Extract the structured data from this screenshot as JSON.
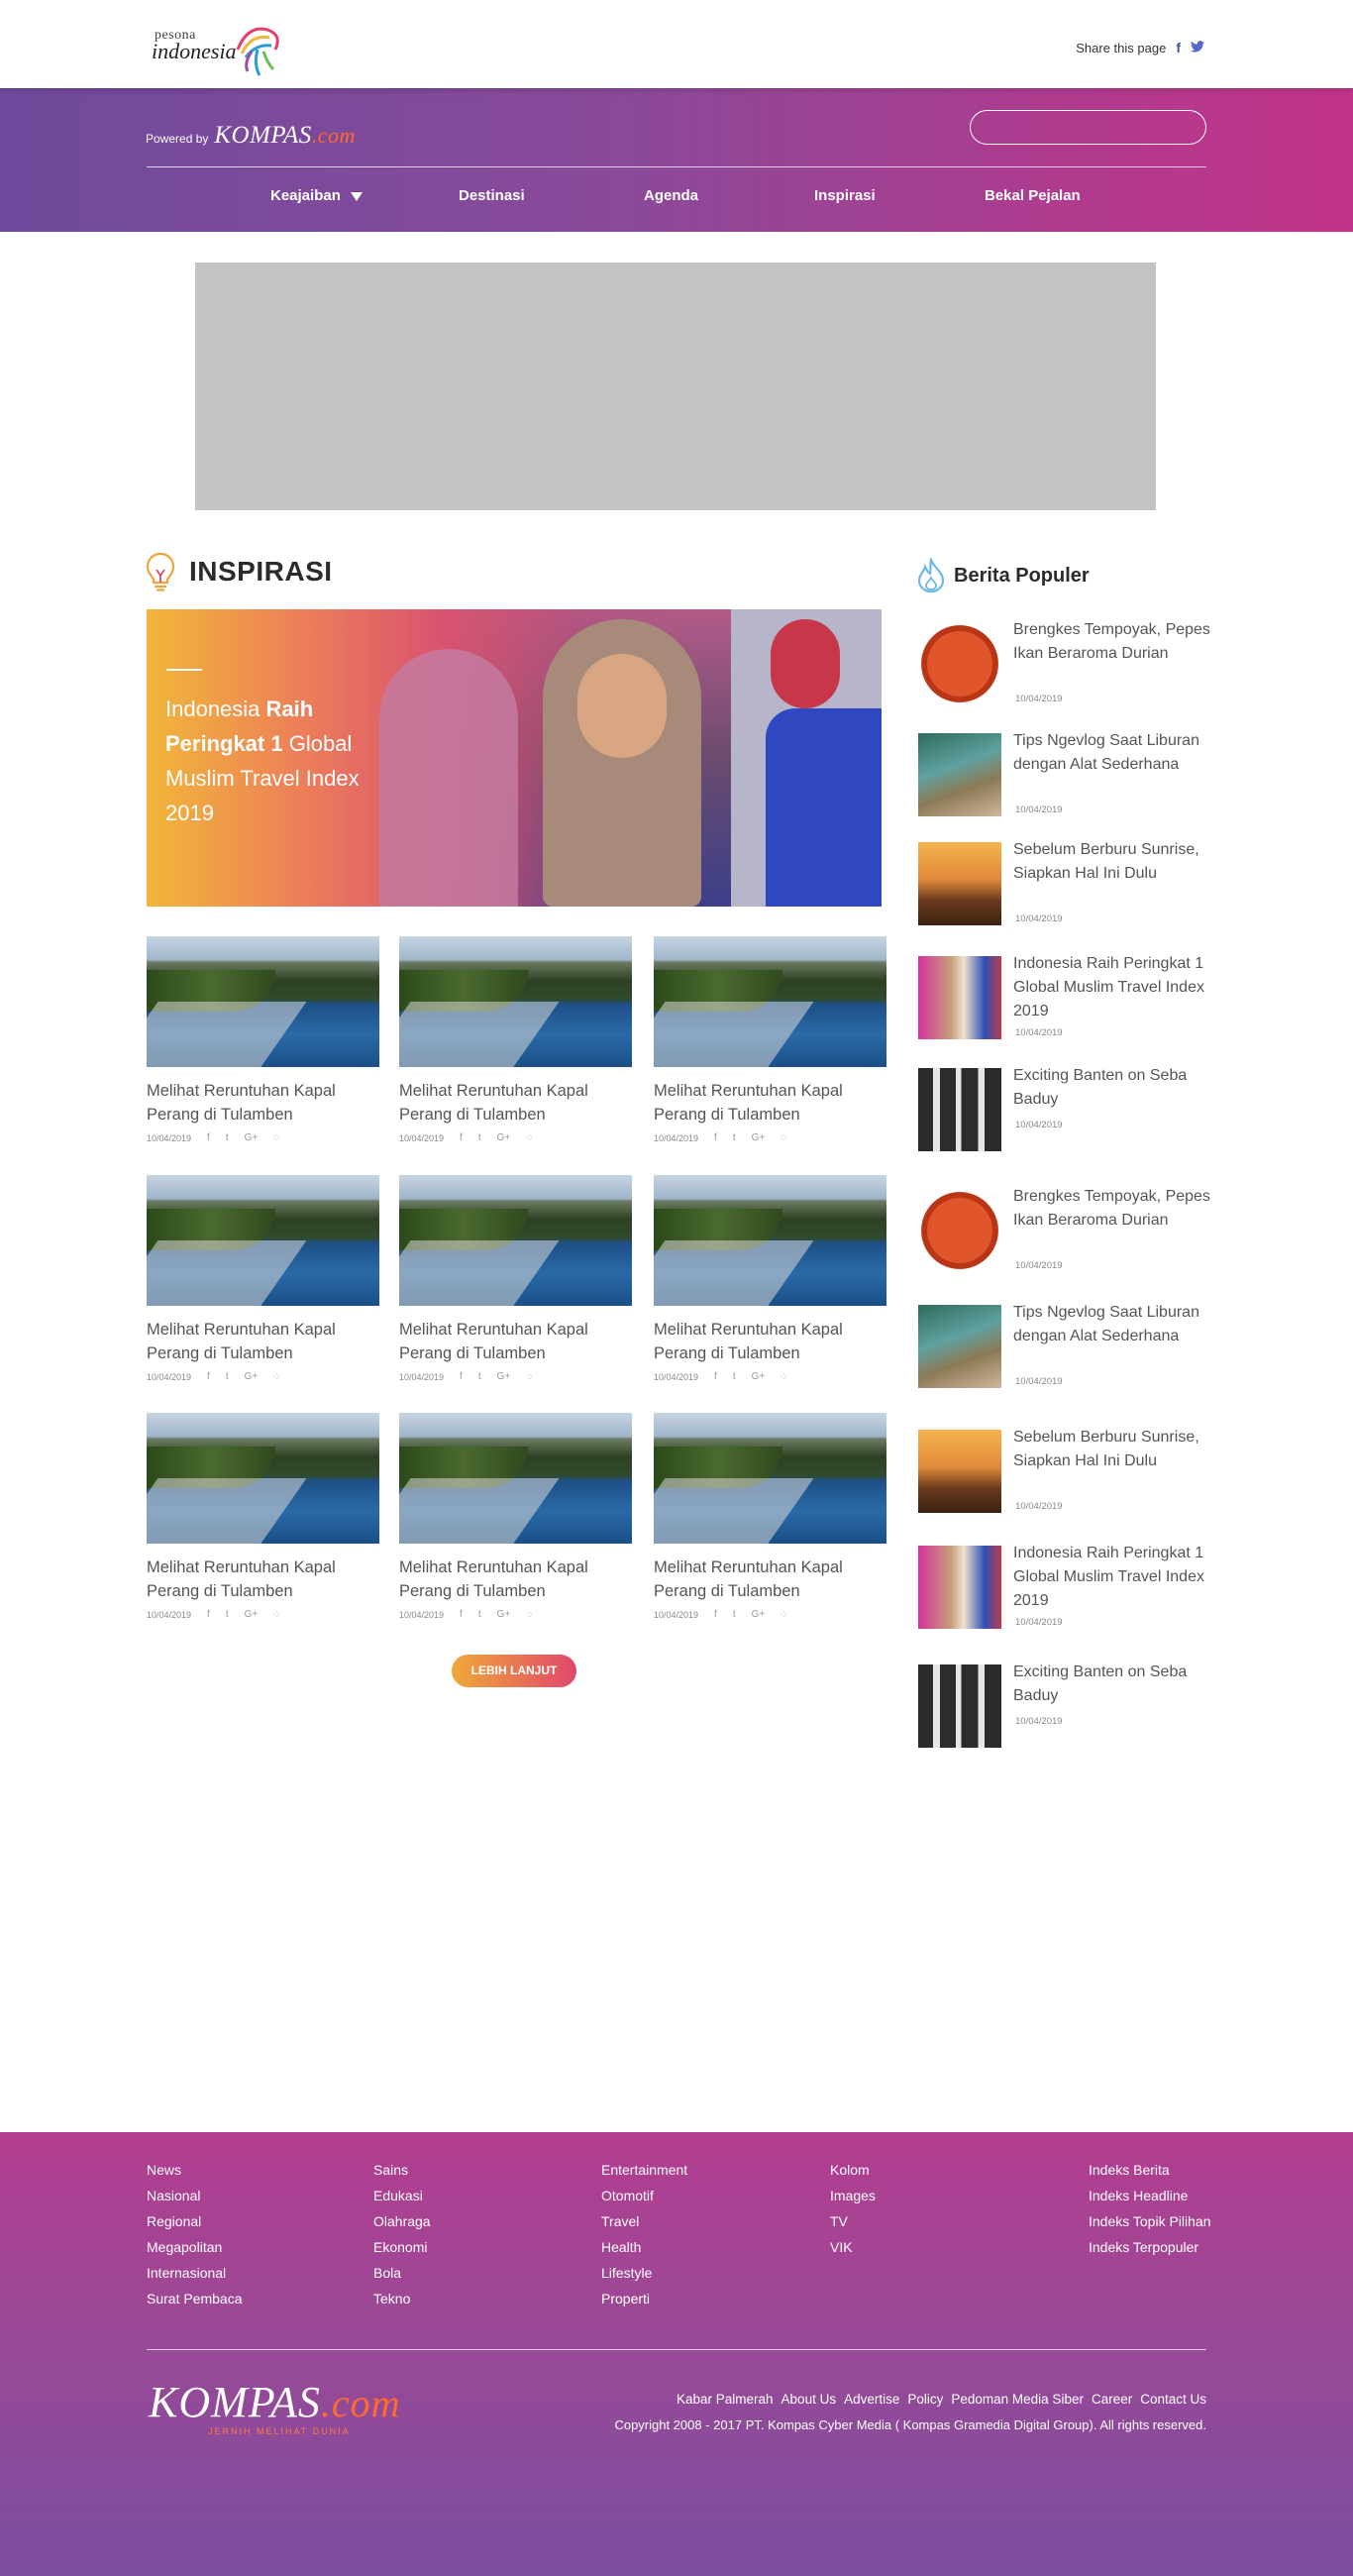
{
  "brand": {
    "pesona": "pesona",
    "indonesia": "indonesia"
  },
  "share": {
    "label": "Share this page",
    "fb": "f",
    "tw": "🐦"
  },
  "header": {
    "powered_by": "Powered by",
    "kompas": "KOMPAS",
    "kompas_dot": ".com",
    "search_placeholder": ""
  },
  "nav": [
    {
      "label": "Keajaiban",
      "caret": true
    },
    {
      "label": "Destinasi"
    },
    {
      "label": "Agenda"
    },
    {
      "label": "Inspirasi"
    },
    {
      "label": "Bekal Pejalan"
    }
  ],
  "section": {
    "title": "INSPIRASI"
  },
  "hero": {
    "pre": "Indonesia ",
    "bold": "Raih Peringkat 1",
    "post": " Global Muslim Travel Index 2019"
  },
  "cards": [
    {
      "title": "Melihat Reruntuhan Kapal Perang di Tulamben",
      "date": "10/04/2019"
    },
    {
      "title": "Melihat Reruntuhan Kapal Perang di Tulamben",
      "date": "10/04/2019"
    },
    {
      "title": "Melihat Reruntuhan Kapal Perang di Tulamben",
      "date": "10/04/2019"
    },
    {
      "title": "Melihat Reruntuhan Kapal Perang di Tulamben",
      "date": "10/04/2019"
    },
    {
      "title": "Melihat Reruntuhan Kapal Perang di Tulamben",
      "date": "10/04/2019"
    },
    {
      "title": "Melihat Reruntuhan Kapal Perang di Tulamben",
      "date": "10/04/2019"
    },
    {
      "title": "Melihat Reruntuhan Kapal Perang di Tulamben",
      "date": "10/04/2019"
    },
    {
      "title": "Melihat Reruntuhan Kapal Perang di Tulamben",
      "date": "10/04/2019"
    },
    {
      "title": "Melihat Reruntuhan Kapal Perang di Tulamben",
      "date": "10/04/2019"
    }
  ],
  "share_icons": {
    "fb": "f",
    "tw": "t",
    "gp": "G+",
    "wa": "◌"
  },
  "more_button": "LEBIH LANJUT",
  "sidebar": {
    "title": "Berita Populer",
    "items": [
      {
        "title": "Brengkes Tempoyak, Pepes Ikan Beraroma Durian",
        "date": "10/04/2019",
        "thumb": "food"
      },
      {
        "title": "Tips Ngevlog Saat Liburan dengan Alat Sederhana",
        "date": "10/04/2019",
        "thumb": "swim"
      },
      {
        "title": "Sebelum Berburu Sunrise, Siapkan Hal Ini Dulu",
        "date": "10/04/2019",
        "thumb": "sun"
      },
      {
        "title": "Indonesia Raih Peringkat 1 Global Muslim Travel Index 2019",
        "date": "10/04/2019",
        "thumb": "hijab"
      },
      {
        "title": "Exciting Banten on Seba Baduy",
        "date": "10/04/2019",
        "thumb": "band"
      },
      {
        "title": "Brengkes Tempoyak, Pepes Ikan Beraroma Durian",
        "date": "10/04/2019",
        "thumb": "food"
      },
      {
        "title": "Tips Ngevlog Saat Liburan dengan Alat Sederhana",
        "date": "10/04/2019",
        "thumb": "swim"
      },
      {
        "title": "Sebelum Berburu Sunrise, Siapkan Hal Ini Dulu",
        "date": "10/04/2019",
        "thumb": "sun"
      },
      {
        "title": "Indonesia Raih Peringkat 1 Global Muslim Travel Index 2019",
        "date": "10/04/2019",
        "thumb": "hijab"
      },
      {
        "title": "Exciting Banten on Seba Baduy",
        "date": "10/04/2019",
        "thumb": "band"
      }
    ]
  },
  "footer": {
    "columns": [
      [
        "News",
        "Nasional",
        "Regional",
        "Megapolitan",
        "Internasional",
        "Surat Pembaca"
      ],
      [
        "Sains",
        "Edukasi",
        "Olahraga",
        "Ekonomi",
        "Bola",
        "Tekno"
      ],
      [
        "Entertainment",
        "Otomotif",
        "Travel",
        "Health",
        "Lifestyle",
        "Properti"
      ],
      [
        "Kolom",
        "Images",
        "TV",
        "VIK"
      ],
      [
        "Indeks Berita",
        "Indeks Headline",
        "Indeks Topik Pilihan",
        "Indeks Terpopuler"
      ]
    ],
    "logo": "KOMPAS",
    "logo_dot": ".com",
    "tagline": "JERNIH MELIHAT DUNIA",
    "links": [
      "Kabar Palmerah",
      "About Us",
      "Advertise",
      "Policy",
      "Pedoman Media Siber",
      "Career",
      "Contact Us"
    ],
    "copyright": "Copyright 2008 - 2017 PT. Kompas Cyber Media ( Kompas Gramedia Digital Group). All rights reserved."
  },
  "colors": {
    "purple": "#7d4ea0",
    "magenta": "#c2348a",
    "orange": "#f0a83a"
  }
}
